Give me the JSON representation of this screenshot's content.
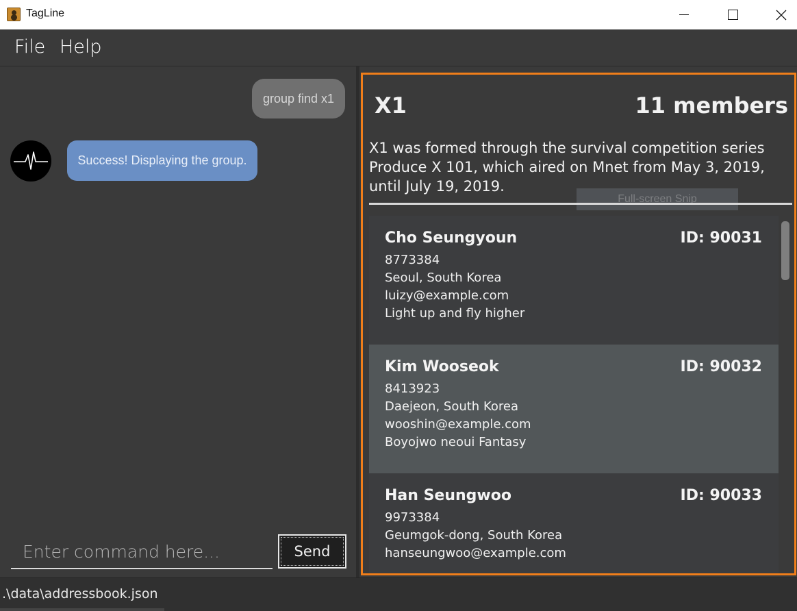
{
  "window": {
    "title": "TagLine",
    "controls": {
      "minimize": "minimize-icon",
      "maximize": "maximize-icon",
      "close": "close-icon"
    }
  },
  "menu": {
    "file": "File",
    "help": "Help"
  },
  "chat": {
    "messages": [
      {
        "sender": "user",
        "text": "group find x1"
      },
      {
        "sender": "bot",
        "text": "Success! Displaying the group."
      }
    ],
    "input_placeholder": "Enter command here...",
    "input_value": "",
    "send_label": "Send"
  },
  "group": {
    "name": "X1",
    "member_count": "11 members",
    "description": "X1 was formed through the survival competition series Produce X 101, which aired on Mnet from May 3, 2019, until July 19, 2019.",
    "overlay_text": "Full-screen Snip",
    "accent_color": "#f07e1a",
    "members": [
      {
        "name": "Cho Seungyoun",
        "id": "ID: 90031",
        "phone": "8773384",
        "address": "Seoul, South Korea",
        "email": "luizy@example.com",
        "note": "Light up and fly higher"
      },
      {
        "name": "Kim Wooseok",
        "id": "ID: 90032",
        "phone": "8413923",
        "address": "Daejeon, South Korea",
        "email": "wooshin@example.com",
        "note": "Boyojwo neoui Fantasy"
      },
      {
        "name": "Han Seungwoo",
        "id": "ID: 90033",
        "phone": "9973384",
        "address": "Geumgok-dong, South Korea",
        "email": "hanseungwoo@example.com",
        "note": ""
      }
    ]
  },
  "status": {
    "path": ".\\data\\addressbook.json"
  },
  "colors": {
    "bot_bubble": "#6a8fc5",
    "user_bubble": "#707070",
    "selected_card": "#525759"
  }
}
